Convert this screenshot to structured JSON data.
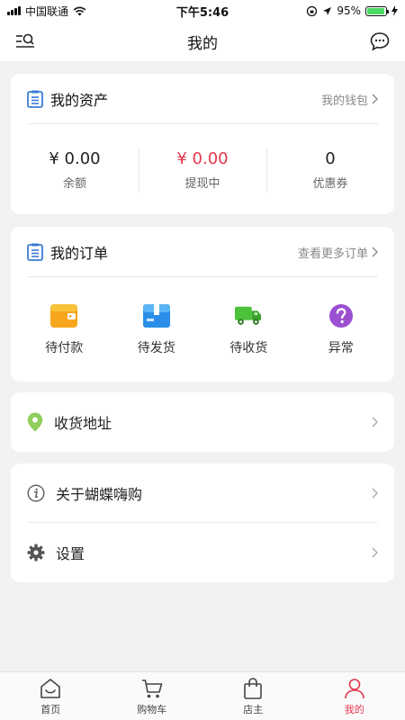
{
  "status_bar": {
    "carrier": "中国联通",
    "time": "下午5:46",
    "battery_percent": "95%",
    "battery_level": 0.95
  },
  "nav": {
    "title": "我的",
    "left_icon": "menu-search-icon",
    "right_icon": "chat-bubble-icon"
  },
  "assets": {
    "title": "我的资产",
    "link_label": "我的钱包",
    "items": [
      {
        "value": "¥ 0.00",
        "label": "余额"
      },
      {
        "value": "¥ 0.00",
        "label": "提现中"
      },
      {
        "value": "0",
        "label": "优惠券"
      }
    ]
  },
  "orders": {
    "title": "我的订单",
    "link_label": "查看更多订单",
    "items": [
      {
        "label": "待付款",
        "icon": "wallet-icon"
      },
      {
        "label": "待发货",
        "icon": "package-icon"
      },
      {
        "label": "待收货",
        "icon": "truck-icon"
      },
      {
        "label": "异常",
        "icon": "question-icon"
      }
    ]
  },
  "address": {
    "label": "收货地址"
  },
  "about": {
    "label": "关于蝴蝶嗨购"
  },
  "settings": {
    "label": "设置"
  },
  "tabs": [
    {
      "label": "首页",
      "icon": "home-icon"
    },
    {
      "label": "购物车",
      "icon": "cart-icon"
    },
    {
      "label": "店主",
      "icon": "shopping-bag-icon"
    },
    {
      "label": "我的",
      "icon": "person-icon"
    }
  ],
  "colors": {
    "accent": "#e5374d",
    "background": "#f2f2f2",
    "card": "#ffffff",
    "header_icon": "#3a7bd5"
  }
}
